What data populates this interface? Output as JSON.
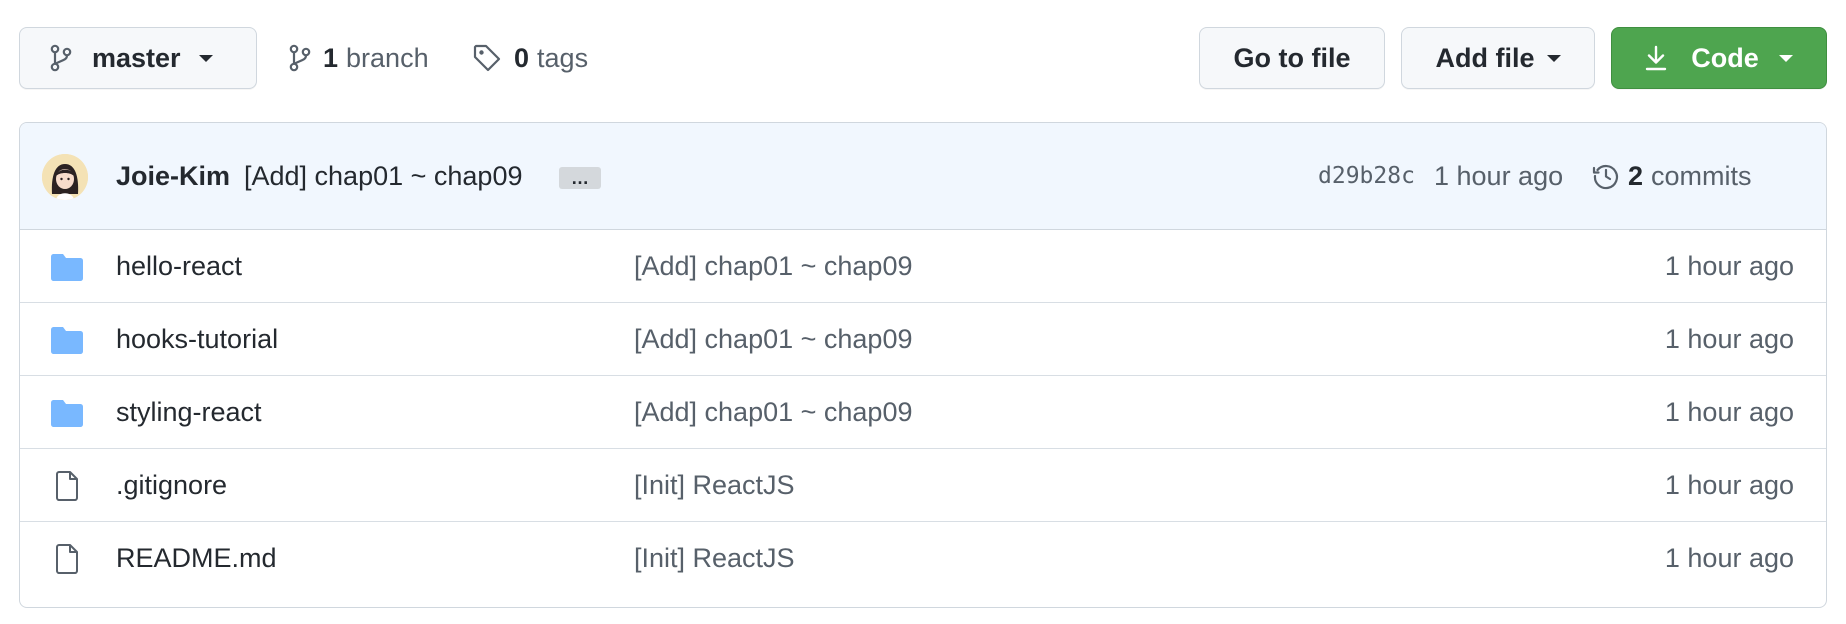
{
  "toolbar": {
    "branch_name": "master",
    "branches_count": "1",
    "branches_label": "branch",
    "tags_count": "0",
    "tags_label": "tags",
    "go_to_file_label": "Go to file",
    "add_file_label": "Add file",
    "code_label": "Code",
    "code_button_color": "#4ea54f"
  },
  "commit": {
    "author": "Joie-Kim",
    "message": "[Add] chap01 ~ chap09",
    "ellipsis": "…",
    "sha": "d29b28c",
    "time": "1 hour ago",
    "commits_count": "2",
    "commits_label": "commits",
    "bar_color": "#f1f7fe"
  },
  "files": [
    {
      "type": "folder",
      "icon": "folder-icon",
      "name": "hello-react",
      "message": "[Add] chap01 ~ chap09",
      "time": "1 hour ago"
    },
    {
      "type": "folder",
      "icon": "folder-icon",
      "name": "hooks-tutorial",
      "message": "[Add] chap01 ~ chap09",
      "time": "1 hour ago"
    },
    {
      "type": "folder",
      "icon": "folder-icon",
      "name": "styling-react",
      "message": "[Add] chap01 ~ chap09",
      "time": "1 hour ago"
    },
    {
      "type": "file",
      "icon": "file-icon",
      "name": ".gitignore",
      "message": "[Init] ReactJS",
      "time": "1 hour ago"
    },
    {
      "type": "file",
      "icon": "file-icon",
      "name": "README.md",
      "message": "[Init] ReactJS",
      "time": "1 hour ago"
    }
  ],
  "colors": {
    "folder_icon": "#79b8ff",
    "muted_text": "#57606a",
    "border": "#d0d7de"
  }
}
